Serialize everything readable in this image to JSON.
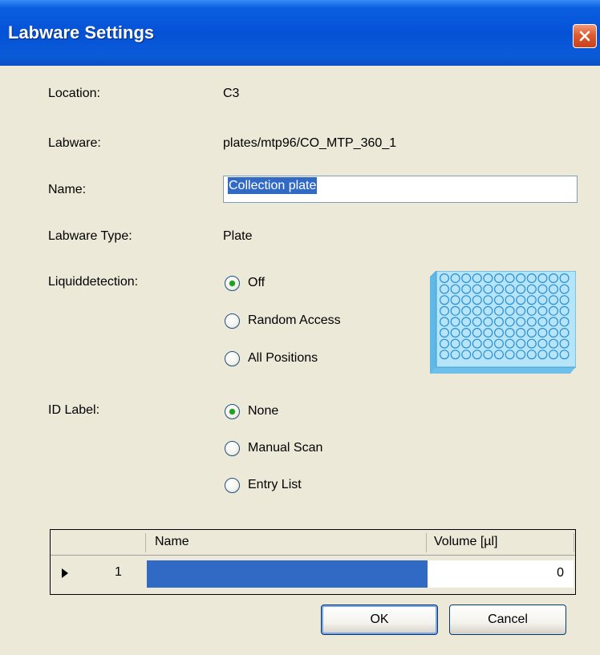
{
  "window": {
    "title": "Labware Settings"
  },
  "fields": {
    "location_label": "Location:",
    "location_value": "C3",
    "labware_label": "Labware:",
    "labware_value": "plates/mtp96/CO_MTP_360_1",
    "name_label": "Name:",
    "name_value": "Collection plate",
    "labware_type_label": "Labware Type:",
    "labware_type_value": "Plate"
  },
  "liquiddetection": {
    "label": "Liquiddetection:",
    "options": [
      {
        "label": "Off",
        "selected": true
      },
      {
        "label": "Random Access",
        "selected": false
      },
      {
        "label": "All Positions",
        "selected": false
      }
    ]
  },
  "id_label": {
    "label": "ID Label:",
    "options": [
      {
        "label": "None",
        "selected": true
      },
      {
        "label": "Manual Scan",
        "selected": false
      },
      {
        "label": "Entry List",
        "selected": false
      }
    ]
  },
  "table": {
    "columns": [
      "Name",
      "Volume [µl]"
    ],
    "rows": [
      {
        "index": "1",
        "name": "",
        "volume": "0"
      }
    ]
  },
  "buttons": {
    "ok": "OK",
    "cancel": "Cancel"
  },
  "icons": {
    "close": "close-icon",
    "plate": "microplate-96-icon",
    "row_marker": "row-pointer-icon"
  },
  "colors": {
    "titlebar": "#0552d6",
    "selection": "#316ac5",
    "radio_dot": "#21a121"
  }
}
